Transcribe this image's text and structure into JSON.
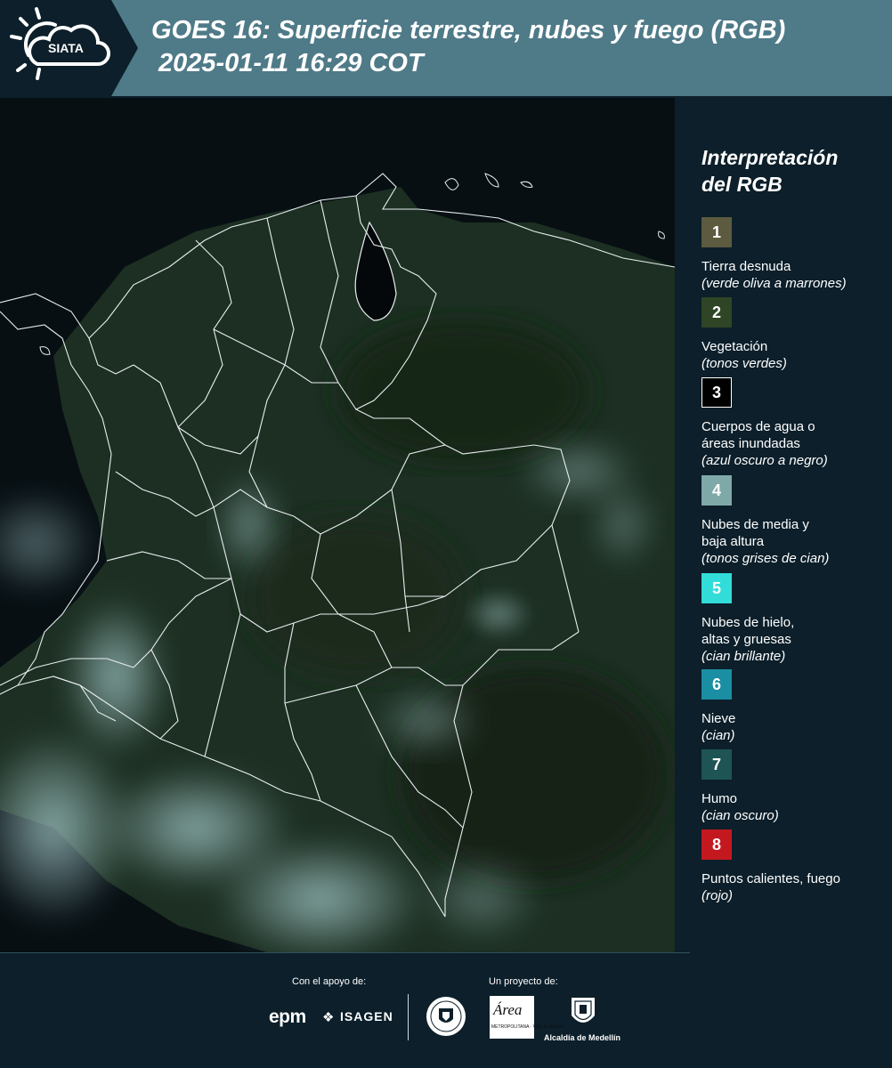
{
  "header": {
    "logo_text": "SIATA",
    "title_line1": "GOES 16: Superficie terrestre, nubes y fuego (RGB)",
    "title_line2": "2025-01-11 16:29 COT"
  },
  "legend": {
    "title_line1": "Interpretación",
    "title_line2": "del RGB",
    "items": [
      {
        "number": "1",
        "color": "#5c5b40",
        "label_lines": [
          "Tierra desnuda"
        ],
        "description": "(verde oliva a marrones)"
      },
      {
        "number": "2",
        "color": "#2f4525",
        "label_lines": [
          "Vegetación"
        ],
        "description": "(tonos verdes)"
      },
      {
        "number": "3",
        "color": "#000000",
        "label_lines": [
          "Cuerpos de agua o",
          "áreas inundadas"
        ],
        "description": "(azul oscuro a negro)"
      },
      {
        "number": "4",
        "color": "#7fa9a8",
        "label_lines": [
          "Nubes de media y",
          "baja altura"
        ],
        "description": "(tonos grises de cian)"
      },
      {
        "number": "5",
        "color": "#31dcd9",
        "label_lines": [
          "Nubes de hielo,",
          "altas y gruesas"
        ],
        "description": "(cian brillante)"
      },
      {
        "number": "6",
        "color": "#1a8ea2",
        "label_lines": [
          "Nieve"
        ],
        "description": "(cian)"
      },
      {
        "number": "7",
        "color": "#1f5454",
        "label_lines": [
          "Humo"
        ],
        "description": "(cian oscuro)"
      },
      {
        "number": "8",
        "color": "#c4181f",
        "label_lines": [
          "Puntos calientes, fuego"
        ],
        "description": "(rojo)"
      }
    ]
  },
  "footer": {
    "support_label": "Con el apoyo de:",
    "project_label": "Un proyecto de:",
    "sponsor_epm": "epm",
    "sponsor_isagen": "ISAGEN",
    "area_logo_text": "Área",
    "area_logo_sub": "METROPOLITANA · Valle de Aburrá",
    "alcaldia": "Alcaldía de Medellín"
  },
  "colors": {
    "header_bg": "#4f7a88",
    "page_bg": "#0c1f2a",
    "map_vegetation": "#1f3324",
    "cloud_cyan": "#9cc7c9"
  }
}
